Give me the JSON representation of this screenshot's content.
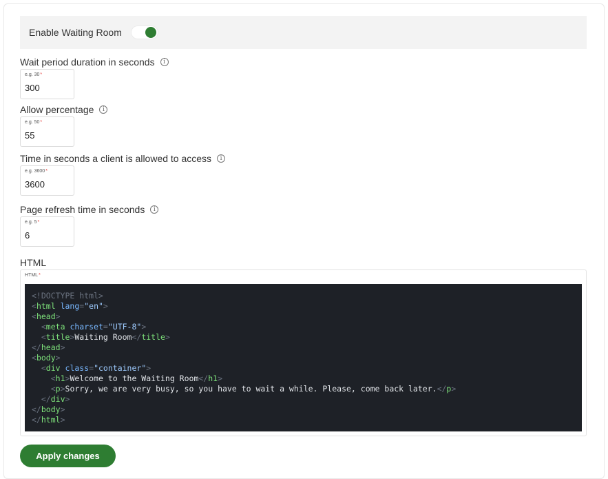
{
  "waiting_room": {
    "label": "Enable Waiting Room",
    "enabled": true
  },
  "fields": [
    {
      "label": "Wait period duration in seconds",
      "placeholder": "e.g. 30",
      "value": "300"
    },
    {
      "label": "Allow percentage",
      "placeholder": "e.g. 50",
      "value": "55"
    },
    {
      "label": "Time in seconds a client is allowed to access",
      "placeholder": "e.g. 3600",
      "value": "3600"
    },
    {
      "label": "Page refresh time in seconds",
      "placeholder": "e.g. 5",
      "value": "6"
    }
  ],
  "required_mark": "*",
  "info_glyph": "i",
  "html_field": {
    "label": "HTML",
    "placeholder": "HTML",
    "code_lines": [
      [
        [
          "p",
          "<!DOCTYPE html>"
        ]
      ],
      [
        [
          "p",
          "<"
        ],
        [
          "t",
          "html"
        ],
        [
          "x",
          " "
        ],
        [
          "a",
          "lang"
        ],
        [
          "p",
          "="
        ],
        [
          "s",
          "\"en\""
        ],
        [
          "p",
          ">"
        ]
      ],
      [
        [
          "p",
          "<"
        ],
        [
          "t",
          "head"
        ],
        [
          "p",
          ">"
        ]
      ],
      [
        [
          "x",
          "  "
        ],
        [
          "p",
          "<"
        ],
        [
          "t",
          "meta"
        ],
        [
          "x",
          " "
        ],
        [
          "a",
          "charset"
        ],
        [
          "p",
          "="
        ],
        [
          "s",
          "\"UTF-8\""
        ],
        [
          "p",
          ">"
        ]
      ],
      [
        [
          "x",
          "  "
        ],
        [
          "p",
          "<"
        ],
        [
          "t",
          "title"
        ],
        [
          "p",
          ">"
        ],
        [
          "x",
          "Waiting Room"
        ],
        [
          "p",
          "</"
        ],
        [
          "t",
          "title"
        ],
        [
          "p",
          ">"
        ]
      ],
      [
        [
          "p",
          "</"
        ],
        [
          "t",
          "head"
        ],
        [
          "p",
          ">"
        ]
      ],
      [
        [
          "p",
          "<"
        ],
        [
          "t",
          "body"
        ],
        [
          "p",
          ">"
        ]
      ],
      [
        [
          "x",
          "  "
        ],
        [
          "p",
          "<"
        ],
        [
          "t",
          "div"
        ],
        [
          "x",
          " "
        ],
        [
          "a",
          "class"
        ],
        [
          "p",
          "="
        ],
        [
          "s",
          "\"container\""
        ],
        [
          "p",
          ">"
        ]
      ],
      [
        [
          "x",
          "    "
        ],
        [
          "p",
          "<"
        ],
        [
          "t",
          "h1"
        ],
        [
          "p",
          ">"
        ],
        [
          "x",
          "Welcome to the Waiting Room"
        ],
        [
          "p",
          "</"
        ],
        [
          "t",
          "h1"
        ],
        [
          "p",
          ">"
        ]
      ],
      [
        [
          "x",
          "    "
        ],
        [
          "p",
          "<"
        ],
        [
          "t",
          "p"
        ],
        [
          "p",
          ">"
        ],
        [
          "x",
          "Sorry, we are very busy, so you have to wait a while. Please, come back later."
        ],
        [
          "p",
          "</"
        ],
        [
          "t",
          "p"
        ],
        [
          "p",
          ">"
        ]
      ],
      [
        [
          "x",
          "  "
        ],
        [
          "p",
          "</"
        ],
        [
          "t",
          "div"
        ],
        [
          "p",
          ">"
        ]
      ],
      [
        [
          "p",
          "</"
        ],
        [
          "t",
          "body"
        ],
        [
          "p",
          ">"
        ]
      ],
      [
        [
          "p",
          "</"
        ],
        [
          "t",
          "html"
        ],
        [
          "p",
          ">"
        ]
      ]
    ]
  },
  "apply_button": {
    "label": "Apply changes"
  },
  "colors": {
    "accent": "#2e7d32",
    "required": "#e53935",
    "code_bg": "#1e2127"
  }
}
